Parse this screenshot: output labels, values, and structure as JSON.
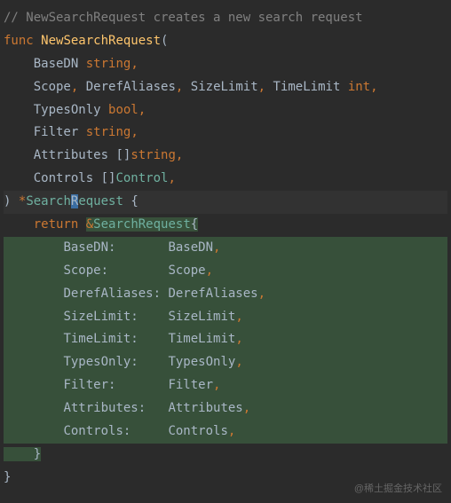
{
  "code": {
    "comment": "// NewSearchRequest creates a new search request",
    "kw_func": "func",
    "funcname": "NewSearchRequest",
    "params": {
      "basedn": "BaseDN",
      "scope": "Scope",
      "deref": "DerefAliases",
      "sizelim": "SizeLimit",
      "timelim": "TimeLimit",
      "typesonly": "TypesOnly",
      "filter": "Filter",
      "attributes": "Attributes",
      "controls": "Controls"
    },
    "types": {
      "string": "string",
      "int": "int",
      "bool": "bool",
      "control": "Control",
      "searchreq": "SearchRequest"
    },
    "kw_return": "return",
    "punct": {
      "comma": ",",
      "lparen": "(",
      "rparen": ")",
      "lbrace": "{",
      "rbrace": "}",
      "star": "*",
      "amp": "&",
      "brackets": "[]",
      "colon": ":"
    },
    "struct_fields": {
      "basedn_k": "BaseDN:       ",
      "scope_k": "Scope:        ",
      "deref_k": "DerefAliases: ",
      "sizelim_k": "SizeLimit:    ",
      "timelim_k": "TimeLimit:    ",
      "typesonly_k": "TypesOnly:    ",
      "filter_k": "Filter:       ",
      "attributes_k": "Attributes:   ",
      "controls_k": "Controls:     "
    }
  },
  "watermark": "@稀土掘金技术社区"
}
